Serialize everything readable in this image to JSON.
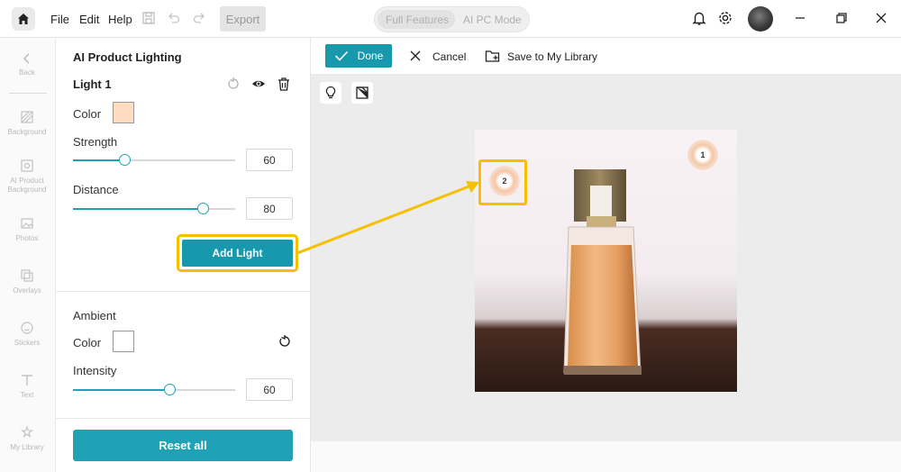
{
  "menu": {
    "file": "File",
    "edit": "Edit",
    "help": "Help",
    "export": "Export"
  },
  "mode_toggle": {
    "full_features": "Full Features",
    "ai_pc_mode": "AI PC Mode"
  },
  "rail": {
    "back": "Back",
    "items": [
      {
        "label": "Background",
        "icon": "background-icon"
      },
      {
        "label": "AI Product Background",
        "icon": "ai-background-icon"
      },
      {
        "label": "Photos",
        "icon": "photos-icon"
      },
      {
        "label": "Overlays",
        "icon": "overlays-icon"
      },
      {
        "label": "Stickers",
        "icon": "stickers-icon"
      },
      {
        "label": "Text",
        "icon": "text-icon"
      },
      {
        "label": "My Library",
        "icon": "library-icon"
      }
    ]
  },
  "panel": {
    "title": "AI Product Lighting",
    "light": {
      "name": "Light 1",
      "color_label": "Color",
      "color": "#fddcc0",
      "strength_label": "Strength",
      "strength": "60",
      "distance_label": "Distance",
      "distance": "80"
    },
    "add_light": "Add Light",
    "ambient": {
      "title": "Ambient",
      "color_label": "Color",
      "color": "#ffffff",
      "intensity_label": "Intensity",
      "intensity": "60"
    },
    "reset_all": "Reset all"
  },
  "action_bar": {
    "done": "Done",
    "cancel": "Cancel",
    "save": "Save to My Library"
  },
  "canvas": {
    "markers": [
      "1",
      "2"
    ]
  },
  "colors": {
    "accent": "#1898ad",
    "highlight": "#f5c000"
  }
}
